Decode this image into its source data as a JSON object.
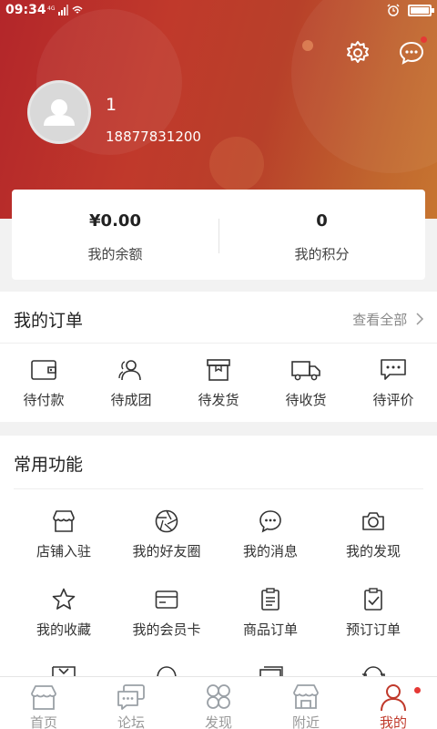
{
  "status_bar": {
    "time": "09:34",
    "signal": "4G"
  },
  "profile": {
    "username": "1",
    "phone": "18877831200"
  },
  "header_icons": {
    "settings": "gear-icon",
    "messages": "chat-icon"
  },
  "account": {
    "balance_value": "¥0.00",
    "balance_label": "我的余额",
    "points_value": "0",
    "points_label": "我的积分"
  },
  "orders": {
    "title": "我的订单",
    "view_all": "查看全部",
    "items": [
      {
        "label": "待付款",
        "icon": "wallet-icon"
      },
      {
        "label": "待成团",
        "icon": "group-icon"
      },
      {
        "label": "待发货",
        "icon": "box-icon"
      },
      {
        "label": "待收货",
        "icon": "truck-icon"
      },
      {
        "label": "待评价",
        "icon": "comment-icon"
      }
    ]
  },
  "functions": {
    "title": "常用功能",
    "items": [
      {
        "label": "店铺入驻",
        "icon": "store-icon"
      },
      {
        "label": "我的好友圈",
        "icon": "aperture-icon"
      },
      {
        "label": "我的消息",
        "icon": "message-icon"
      },
      {
        "label": "我的发现",
        "icon": "camera-icon"
      },
      {
        "label": "我的收藏",
        "icon": "star-icon"
      },
      {
        "label": "我的会员卡",
        "icon": "card-icon"
      },
      {
        "label": "商品订单",
        "icon": "clipboard-icon"
      },
      {
        "label": "预订订单",
        "icon": "clipboard-check-icon"
      }
    ]
  },
  "tabbar": {
    "items": [
      {
        "label": "首页",
        "icon": "home-icon"
      },
      {
        "label": "论坛",
        "icon": "forum-icon"
      },
      {
        "label": "发现",
        "icon": "discover-icon"
      },
      {
        "label": "附近",
        "icon": "nearby-icon"
      },
      {
        "label": "我的",
        "icon": "user-icon"
      }
    ],
    "active": "我的"
  },
  "colors": {
    "brand": "#c0392b",
    "badge": "#e53935"
  }
}
